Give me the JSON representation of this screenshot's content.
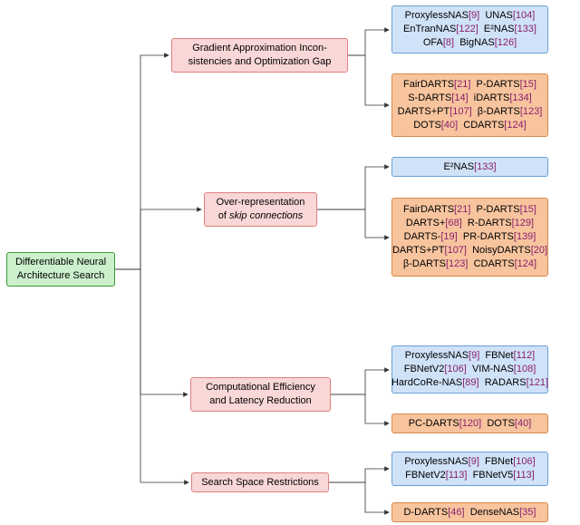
{
  "root": {
    "line1": "Differentiable Neural",
    "line2": "Architecture Search"
  },
  "categories": {
    "grad": {
      "line1": "Gradient Approximation Incon-",
      "line2": "sistencies and Optimization Gap"
    },
    "skip": {
      "line1": "Over-representation",
      "line2_pre": "of ",
      "line2_ital": "skip connections"
    },
    "comp": {
      "line1": "Computational Efficiency",
      "line2": "and Latency Reduction"
    },
    "space": {
      "line1": "Search Space Restrictions"
    }
  },
  "leaves": {
    "grad_blue": [
      [
        "ProxylessNAS",
        "[9]",
        "UNAS",
        "[104]"
      ],
      [
        "EnTranNAS",
        "[122]",
        "E²NAS",
        "[133]"
      ],
      [
        "OFA",
        "[8]",
        "BigNAS",
        "[126]"
      ]
    ],
    "grad_orange": [
      [
        "FairDARTS",
        "[21]",
        "P-DARTS",
        "[15]"
      ],
      [
        "S-DARTS",
        "[14]",
        "iDARTS",
        "[134]"
      ],
      [
        "DARTS+PT",
        "[107]",
        "β-DARTS",
        "[123]"
      ],
      [
        "DOTS",
        "[40]",
        "CDARTS",
        "[124]"
      ]
    ],
    "skip_blue": [
      [
        "E²NAS",
        "[133]"
      ]
    ],
    "skip_orange": [
      [
        "FairDARTS",
        "[21]",
        "P-DARTS",
        "[15]"
      ],
      [
        "DARTS+",
        "[68]",
        "R-DARTS",
        "[129]"
      ],
      [
        "DARTS-",
        "[19]",
        "PR-DARTS",
        "[139]"
      ],
      [
        "DARTS+PT",
        "[107]",
        "NoisyDARTS",
        "[20]"
      ],
      [
        "β-DARTS",
        "[123]",
        "CDARTS",
        "[124]"
      ]
    ],
    "comp_blue": [
      [
        "ProxylessNAS",
        "[9]",
        "FBNet",
        "[112]"
      ],
      [
        "FBNetV2",
        "[106]",
        "VIM-NAS",
        "[108]"
      ],
      [
        "HardCoRe-NAS",
        "[89]",
        "RADARS",
        "[121]"
      ]
    ],
    "comp_orange": [
      [
        "PC-DARTS",
        "[120]",
        "DOTS",
        "[40]"
      ]
    ],
    "space_blue": [
      [
        "ProxylessNAS",
        "[9]",
        "FBNet",
        "[106]"
      ],
      [
        "FBNetV2",
        "[113]",
        "FBNetV5",
        "[113]"
      ]
    ],
    "space_orange": [
      [
        "D-DARTS",
        "[46]",
        "DenseNAS",
        "[35]"
      ]
    ]
  },
  "chart_data": {
    "type": "tree",
    "root": "Differentiable Neural Architecture Search",
    "children": [
      {
        "label": "Gradient Approximation Inconsistencies and Optimization Gap",
        "children": [
          {
            "group": "blue",
            "methods": [
              "ProxylessNAS[9]",
              "UNAS[104]",
              "EnTranNAS[122]",
              "E²NAS[133]",
              "OFA[8]",
              "BigNAS[126]"
            ]
          },
          {
            "group": "orange",
            "methods": [
              "FairDARTS[21]",
              "P-DARTS[15]",
              "S-DARTS[14]",
              "iDARTS[134]",
              "DARTS+PT[107]",
              "β-DARTS[123]",
              "DOTS[40]",
              "CDARTS[124]"
            ]
          }
        ]
      },
      {
        "label": "Over-representation of skip connections",
        "children": [
          {
            "group": "blue",
            "methods": [
              "E²NAS[133]"
            ]
          },
          {
            "group": "orange",
            "methods": [
              "FairDARTS[21]",
              "P-DARTS[15]",
              "DARTS+[68]",
              "R-DARTS[129]",
              "DARTS-[19]",
              "PR-DARTS[139]",
              "DARTS+PT[107]",
              "NoisyDARTS[20]",
              "β-DARTS[123]",
              "CDARTS[124]"
            ]
          }
        ]
      },
      {
        "label": "Computational Efficiency and Latency Reduction",
        "children": [
          {
            "group": "blue",
            "methods": [
              "ProxylessNAS[9]",
              "FBNet[112]",
              "FBNetV2[106]",
              "VIM-NAS[108]",
              "HardCoRe-NAS[89]",
              "RADARS[121]"
            ]
          },
          {
            "group": "orange",
            "methods": [
              "PC-DARTS[120]",
              "DOTS[40]"
            ]
          }
        ]
      },
      {
        "label": "Search Space Restrictions",
        "children": [
          {
            "group": "blue",
            "methods": [
              "ProxylessNAS[9]",
              "FBNet[106]",
              "FBNetV2[113]",
              "FBNetV5[113]"
            ]
          },
          {
            "group": "orange",
            "methods": [
              "D-DARTS[46]",
              "DenseNAS[35]"
            ]
          }
        ]
      }
    ]
  }
}
